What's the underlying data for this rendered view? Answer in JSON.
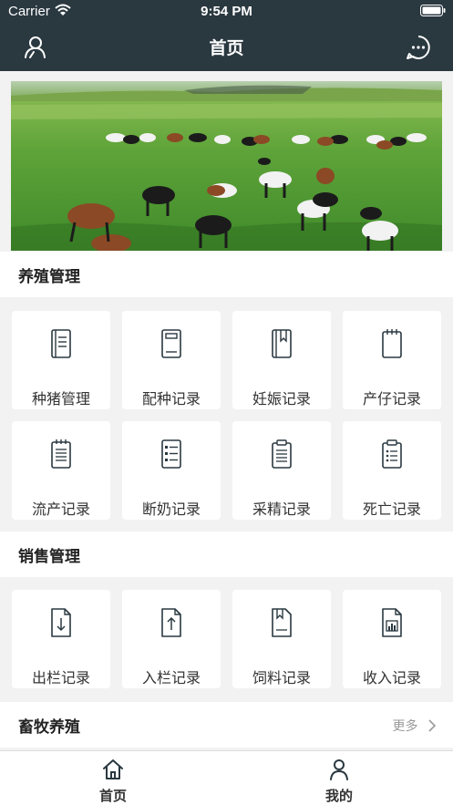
{
  "status_bar": {
    "carrier": "Carrier",
    "time": "9:54 PM"
  },
  "nav": {
    "title": "首页",
    "left_icon": "user-icon",
    "right_icon": "message-icon"
  },
  "banner": {
    "alt": "cows-grazing-banner"
  },
  "sections": {
    "breeding": {
      "title": "养殖管理",
      "items": [
        {
          "label": "种猪管理",
          "icon": "notebook-icon"
        },
        {
          "label": "配种记录",
          "icon": "notepad-icon"
        },
        {
          "label": "妊娠记录",
          "icon": "bookmark-book-icon"
        },
        {
          "label": "产仔记录",
          "icon": "spiral-notepad-icon"
        },
        {
          "label": "流产记录",
          "icon": "lined-notebook-icon"
        },
        {
          "label": "断奶记录",
          "icon": "checklist-icon"
        },
        {
          "label": "采精记录",
          "icon": "clipboard-icon"
        },
        {
          "label": "死亡记录",
          "icon": "clipboard-list-icon"
        }
      ]
    },
    "sales": {
      "title": "销售管理",
      "items": [
        {
          "label": "出栏记录",
          "icon": "file-download-icon"
        },
        {
          "label": "入栏记录",
          "icon": "file-upload-icon"
        },
        {
          "label": "饲料记录",
          "icon": "file-bookmark-icon"
        },
        {
          "label": "收入记录",
          "icon": "file-chart-icon"
        }
      ]
    },
    "livestock": {
      "title": "畜牧养殖",
      "more": "更多"
    }
  },
  "tabbar": {
    "tabs": [
      {
        "label": "首页",
        "icon": "home-icon"
      },
      {
        "label": "我的",
        "icon": "profile-icon"
      }
    ]
  },
  "colors": {
    "header_bg": "#2a3840",
    "page_bg": "#f2f2f2",
    "tile_bg": "#ffffff",
    "icon_stroke": "#2a3840"
  }
}
